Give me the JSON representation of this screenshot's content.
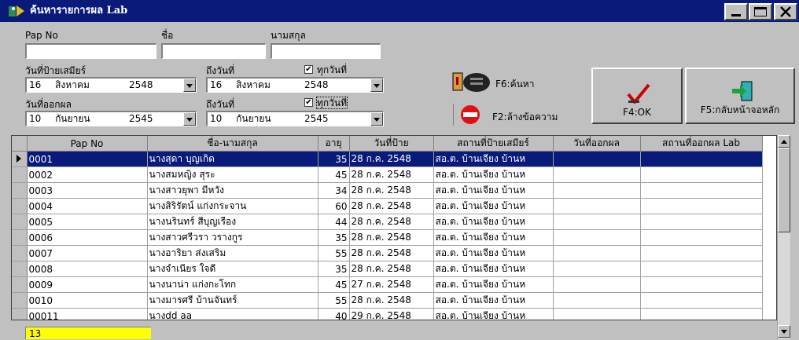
{
  "window": {
    "title": "ค้นหารายการผล Lab"
  },
  "search": {
    "pap_no_label": "Pap No",
    "name_label": "ชื่อ",
    "surname_label": "นามสกุล",
    "pap_no_value": "",
    "name_value": "",
    "surname_value": ""
  },
  "collect_date": {
    "from_label": "วันที่ป้ายเสมียร์",
    "to_label": "ถึงวันที่",
    "all_label": "ทุกวันที่",
    "all_checked": "✔",
    "from": {
      "day": "16",
      "month": "สิงหาคม",
      "year": "2548"
    },
    "to": {
      "day": "16",
      "month": "สิงหาคม",
      "year": "2548"
    }
  },
  "result_date": {
    "from_label": "วันที่ออกผล",
    "to_label": "ถึงวันที่",
    "all_label": "ทุกวันที่",
    "all_checked": "✔",
    "from": {
      "day": "10",
      "month": "กันยายน",
      "year": "2545"
    },
    "to": {
      "day": "10",
      "month": "กันยายน",
      "year": "2545"
    }
  },
  "actions": {
    "search_label": "F6:ค้นหา",
    "clear_label": "F2:ล้างข้อความ",
    "ok_label": "F4:OK",
    "back_label": "F5:กลับหน้าจอหลัก"
  },
  "table": {
    "columns": [
      "Pap No",
      "ชื่อ-นามสกุล",
      "อายุ",
      "วันที่ป้าย",
      "สถานที่ป้ายเสมียร์",
      "วันที่ออกผล",
      "สถานที่ออกผล Lab"
    ],
    "rows": [
      [
        "0001",
        "นางสุดา บุญเกิด",
        "35",
        "28 ก.ค. 2548",
        "สอ.ต. บ้านเจียง บ้านห",
        "",
        ""
      ],
      [
        "0002",
        "นางสมหญิง สุระ",
        "45",
        "28 ก.ค. 2548",
        "สอ.ต. บ้านเจียง บ้านห",
        "",
        ""
      ],
      [
        "0003",
        "นางสาวยุพา มีหวัง",
        "34",
        "28 ก.ค. 2548",
        "สอ.ต. บ้านเจียง บ้านห",
        "",
        ""
      ],
      [
        "0004",
        "นางสิริรัตน์ แก่งกระจาน",
        "60",
        "28 ก.ค. 2548",
        "สอ.ต. บ้านเจียง บ้านห",
        "",
        ""
      ],
      [
        "0005",
        "นางนรินทร์ สีบุญเรือง",
        "44",
        "28 ก.ค. 2548",
        "สอ.ต. บ้านเจียง บ้านห",
        "",
        ""
      ],
      [
        "0006",
        "นางสาวศรีวรา วรางกูร",
        "35",
        "28 ก.ค. 2548",
        "สอ.ต. บ้านเจียง บ้านห",
        "",
        ""
      ],
      [
        "0007",
        "นางอาริยา ส่งเสริม",
        "55",
        "28 ก.ค. 2548",
        "สอ.ต. บ้านเจียง บ้านห",
        "",
        ""
      ],
      [
        "0008",
        "นางจำเนียร ใจดี",
        "35",
        "28 ก.ค. 2548",
        "สอ.ต. บ้านเจียง บ้านห",
        "",
        ""
      ],
      [
        "0009",
        "นางนาน่า แก่งกะโทก",
        "45",
        "27 ก.ค. 2548",
        "สอ.ต. บ้านเจียง บ้านห",
        "",
        ""
      ],
      [
        "0010",
        "นางมารศรี บ้านจันทร์",
        "55",
        "28 ก.ค. 2548",
        "สอ.ต. บ้านเจียง บ้านห",
        "",
        ""
      ],
      [
        "00011",
        "นางdd aa",
        "40",
        "29 ก.ค. 2548",
        "สอ.ต. บ้านเจียง บ้านห",
        "",
        ""
      ]
    ],
    "selected_row": 0
  },
  "status": {
    "count": "13",
    "highlight_color": "#ffff00"
  },
  "colors": {
    "title_bar": "#0a1a7a",
    "selection": "#0a1a7a",
    "ok_check": "#cc0000"
  }
}
